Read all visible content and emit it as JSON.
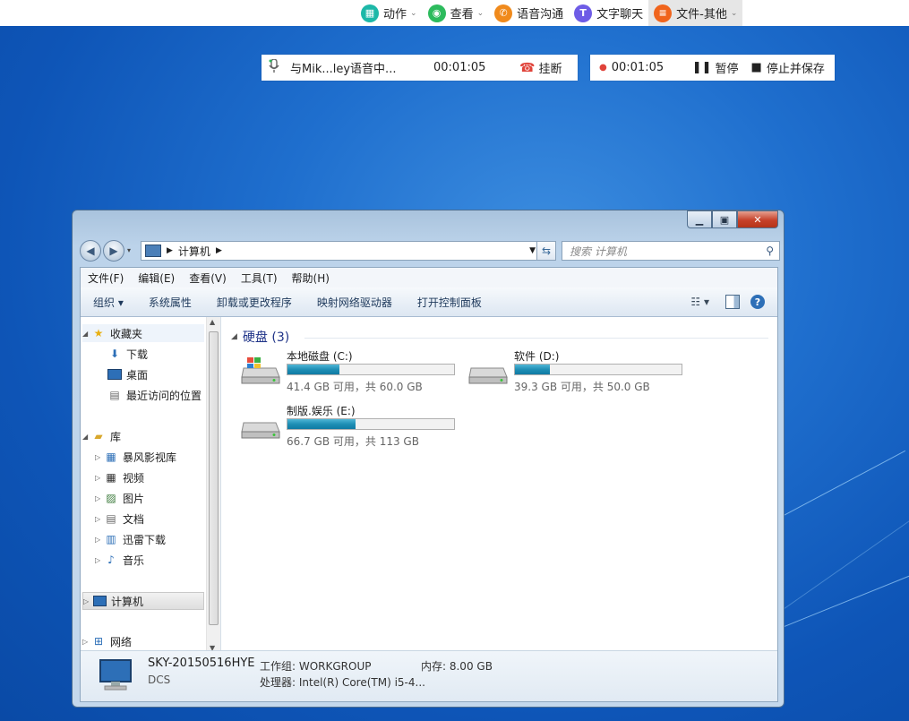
{
  "toolbar": {
    "items": [
      {
        "label": "动作",
        "icon": "grid-icon",
        "color": "#1db8a8",
        "chevron": true
      },
      {
        "label": "查看",
        "icon": "eye-icon",
        "color": "#2dbb5d",
        "chevron": true
      },
      {
        "label": "语音沟通",
        "icon": "phone-icon",
        "color": "#f08a1c",
        "chevron": false
      },
      {
        "label": "文字聊天",
        "icon": "text-chat-icon",
        "color": "#6e5ce6",
        "chevron": false
      },
      {
        "label": "文件-其他",
        "icon": "file-icon",
        "color": "#f0641c",
        "chevron": true
      }
    ]
  },
  "voice_call": {
    "title": "与Mik...ley语音中...",
    "duration": "00:01:05",
    "hangup_label": "挂断"
  },
  "recording": {
    "duration": "00:01:05",
    "pause_label": "暂停",
    "stop_save_label": "停止并保存"
  },
  "explorer": {
    "address": "计算机",
    "search_placeholder": "搜索 计算机",
    "menu": [
      "文件(F)",
      "编辑(E)",
      "查看(V)",
      "工具(T)",
      "帮助(H)"
    ],
    "commands": {
      "organize": "组织 ▾",
      "items": [
        "系统属性",
        "卸载或更改程序",
        "映射网络驱动器",
        "打开控制面板"
      ]
    },
    "nav": {
      "favorites": "收藏夹",
      "favorites_items": [
        "下载",
        "桌面",
        "最近访问的位置"
      ],
      "library": "库",
      "library_items": [
        "暴风影视库",
        "视频",
        "图片",
        "文档",
        "迅雷下载",
        "音乐"
      ],
      "computer": "计算机",
      "network": "网络"
    },
    "group_title": "硬盘 (3)",
    "drives": [
      {
        "name": "本地磁盘 (C:)",
        "info": "41.4 GB 可用，共 60.0 GB",
        "used_fraction": 0.31
      },
      {
        "name": "软件 (D:)",
        "info": "39.3 GB 可用，共 50.0 GB",
        "used_fraction": 0.21
      },
      {
        "name": "制版.娱乐 (E:)",
        "info": "66.7 GB 可用，共 113 GB",
        "used_fraction": 0.41
      }
    ],
    "details": {
      "computer_name": "SKY-20150516HYE",
      "domain": "DCS",
      "workgroup": "工作组: WORKGROUP",
      "memory": "内存: 8.00 GB",
      "processor": "处理器: Intel(R) Core(TM) i5-4..."
    }
  }
}
